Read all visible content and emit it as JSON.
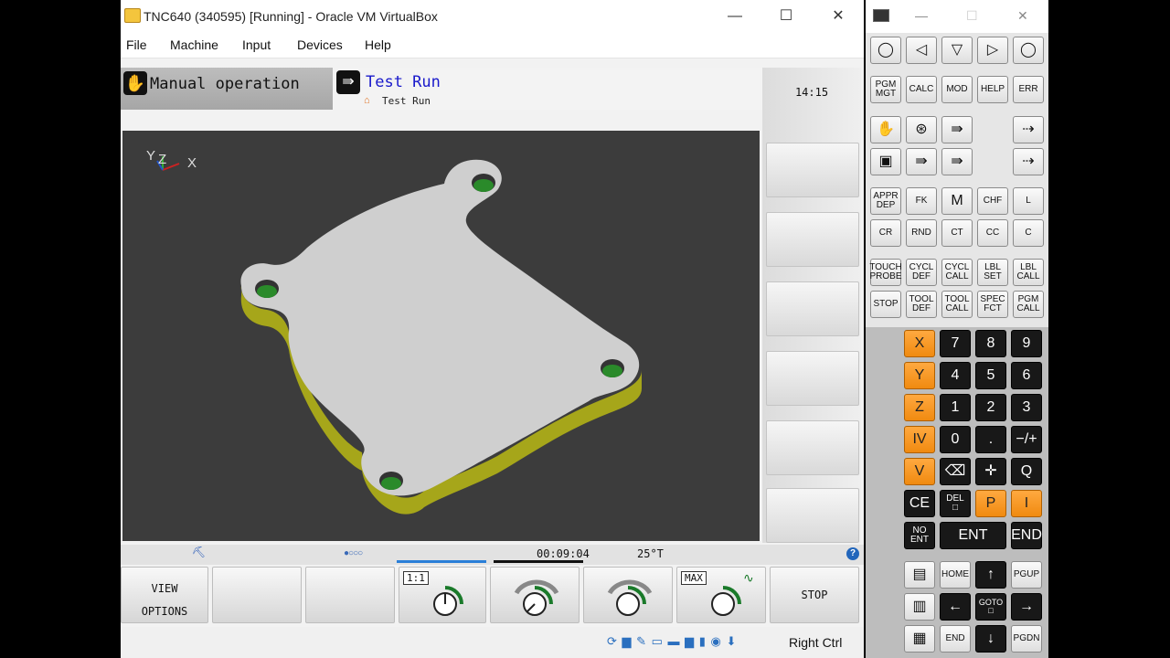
{
  "vbox": {
    "title": "TNC640 (340595) [Running] - Oracle VM VirtualBox",
    "controls": {
      "minimize": "—",
      "maximize": "☐",
      "close": "✕"
    },
    "menu": [
      "File",
      "Machine",
      "Input",
      "Devices",
      "Help"
    ],
    "host_key": "Right Ctrl"
  },
  "tnc": {
    "mode_machine": "Manual operation",
    "mode_program": "Test Run",
    "mode_program_sub": "Test Run",
    "clock": "14:15",
    "run_time": "00:09:04",
    "temperature": "25°T",
    "softkeys": {
      "view_options": [
        "VIEW",
        "OPTIONS"
      ],
      "stop": "STOP",
      "ratio_tag": "1:1",
      "max_tag": "MAX"
    },
    "axes": {
      "x": "X",
      "y": "Y",
      "z": "Z"
    },
    "help": "?"
  },
  "keyboard": {
    "row_nav": [
      "◯",
      "◁",
      "▽",
      "▷",
      "◯"
    ],
    "row_pgm": [
      "PGM\nMGT",
      "CALC",
      "MOD",
      "HELP",
      "ERR"
    ],
    "row_path": [
      "APPR\nDEP",
      "FK",
      "M",
      "CHF",
      "L"
    ],
    "row_path2": [
      "CR",
      "RND",
      "CT",
      "CC",
      "C"
    ],
    "row_cycl": [
      "TOUCH\nPROBE",
      "CYCL\nDEF",
      "CYCL\nCALL",
      "LBL\nSET",
      "LBL\nCALL"
    ],
    "row_tool": [
      "STOP",
      "TOOL\nDEF",
      "TOOL\nCALL",
      "SPEC\nFCT",
      "PGM\nCALL"
    ],
    "axes": [
      "X",
      "Y",
      "Z",
      "IV",
      "V"
    ],
    "digits": [
      [
        "7",
        "8",
        "9"
      ],
      [
        "4",
        "5",
        "6"
      ],
      [
        "1",
        "2",
        "3"
      ],
      [
        "0",
        ".",
        "−/+"
      ]
    ],
    "row_q": [
      "⌫",
      "✛",
      "Q"
    ],
    "ce": "CE",
    "del": "DEL\n□",
    "p": "P",
    "i": "I",
    "noent": "NO\nENT",
    "ent": "ENT",
    "end": "END",
    "home": "HOME",
    "pgup": "PGUP",
    "goto": "GOTO\n□",
    "end2": "END",
    "pgdn": "PGDN"
  }
}
